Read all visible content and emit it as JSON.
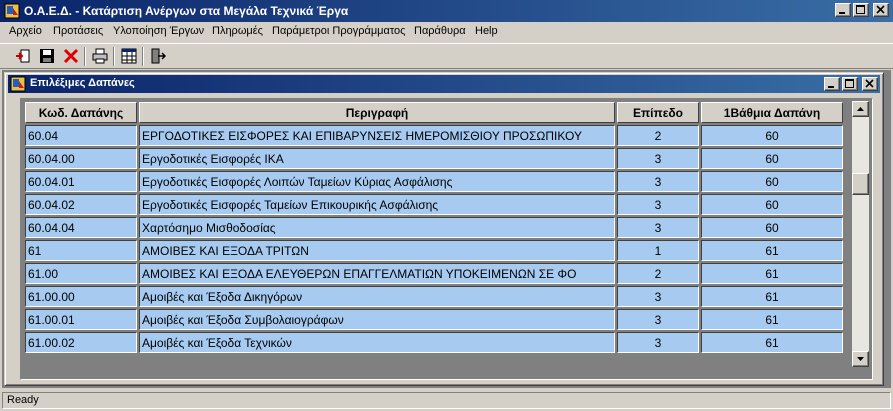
{
  "window": {
    "title": "Ο.Α.Ε.Δ. - Κατάρτιση Ανέργων στα Μεγάλα Τεχνικά Έργα"
  },
  "menu": {
    "items": [
      {
        "label": "Αρχείο"
      },
      {
        "label": "Προτάσεις"
      },
      {
        "label": "Υλοποίηση Έργων"
      },
      {
        "label": "Πληρωμές"
      },
      {
        "label": "Παράμετροι Προγράμματος"
      },
      {
        "label": "Παράθυρα"
      },
      {
        "label": "Help"
      }
    ]
  },
  "toolbar": {
    "icons": [
      "import-icon",
      "save-icon",
      "delete-icon",
      "print-icon",
      "grid-view-icon",
      "exit-icon"
    ]
  },
  "child_window": {
    "title": "Επιλέξιμες Δαπάνες"
  },
  "grid": {
    "columns": [
      "Κωδ. Δαπάνης",
      "Περιγραφή",
      "Επίπεδο",
      "1Βάθμια Δαπάνη"
    ],
    "rows": [
      [
        "60.04",
        "ΕΡΓΟΔΟΤΙΚΕΣ ΕΙΣΦΟΡΕΣ ΚΑΙ ΕΠΙΒΑΡΥΝΣΕΙΣ ΗΜΕΡΟΜΙΣΘΙΟΥ ΠΡΟΣΩΠΙΚΟΥ",
        "2",
        "60"
      ],
      [
        "60.04.00",
        "Εργοδοτικές Εισφορές ΙΚΑ",
        "3",
        "60"
      ],
      [
        "60.04.01",
        "Εργοδοτικές Εισφορές Λοιπών Ταμείων Κύριας Ασφάλισης",
        "3",
        "60"
      ],
      [
        "60.04.02",
        "Εργοδοτικές Εισφορές Ταμείων Επικουρικής Ασφάλισης",
        "3",
        "60"
      ],
      [
        "60.04.04",
        "Χαρτόσημο Μισθοδοσίας",
        "3",
        "60"
      ],
      [
        "61",
        "ΑΜΟΙΒΕΣ ΚΑΙ ΕΞΟΔΑ ΤΡΙΤΩΝ",
        "1",
        "61"
      ],
      [
        "61.00",
        "ΑΜΟΙΒΕΣ ΚΑΙ ΕΞΟΔΑ ΕΛΕΥΘΕΡΩΝ ΕΠΑΓΓΕΛΜΑΤΙΩΝ ΥΠΟΚΕΙΜΕΝΩΝ ΣΕ ΦΟ",
        "2",
        "61"
      ],
      [
        "61.00.00",
        "Αμοιβές και Έξοδα Δικηγόρων",
        "3",
        "61"
      ],
      [
        "61.00.01",
        "Αμοιβές και Έξοδα Συμβολαιογράφων",
        "3",
        "61"
      ],
      [
        "61.00.02",
        "Αμοιβές και Έξοδα Τεχνικών",
        "3",
        "61"
      ]
    ]
  },
  "status": {
    "text": "Ready"
  },
  "colors": {
    "title_bar": "#0a246a",
    "row_fill": "#a6caf0",
    "face": "#d4d0c8"
  }
}
